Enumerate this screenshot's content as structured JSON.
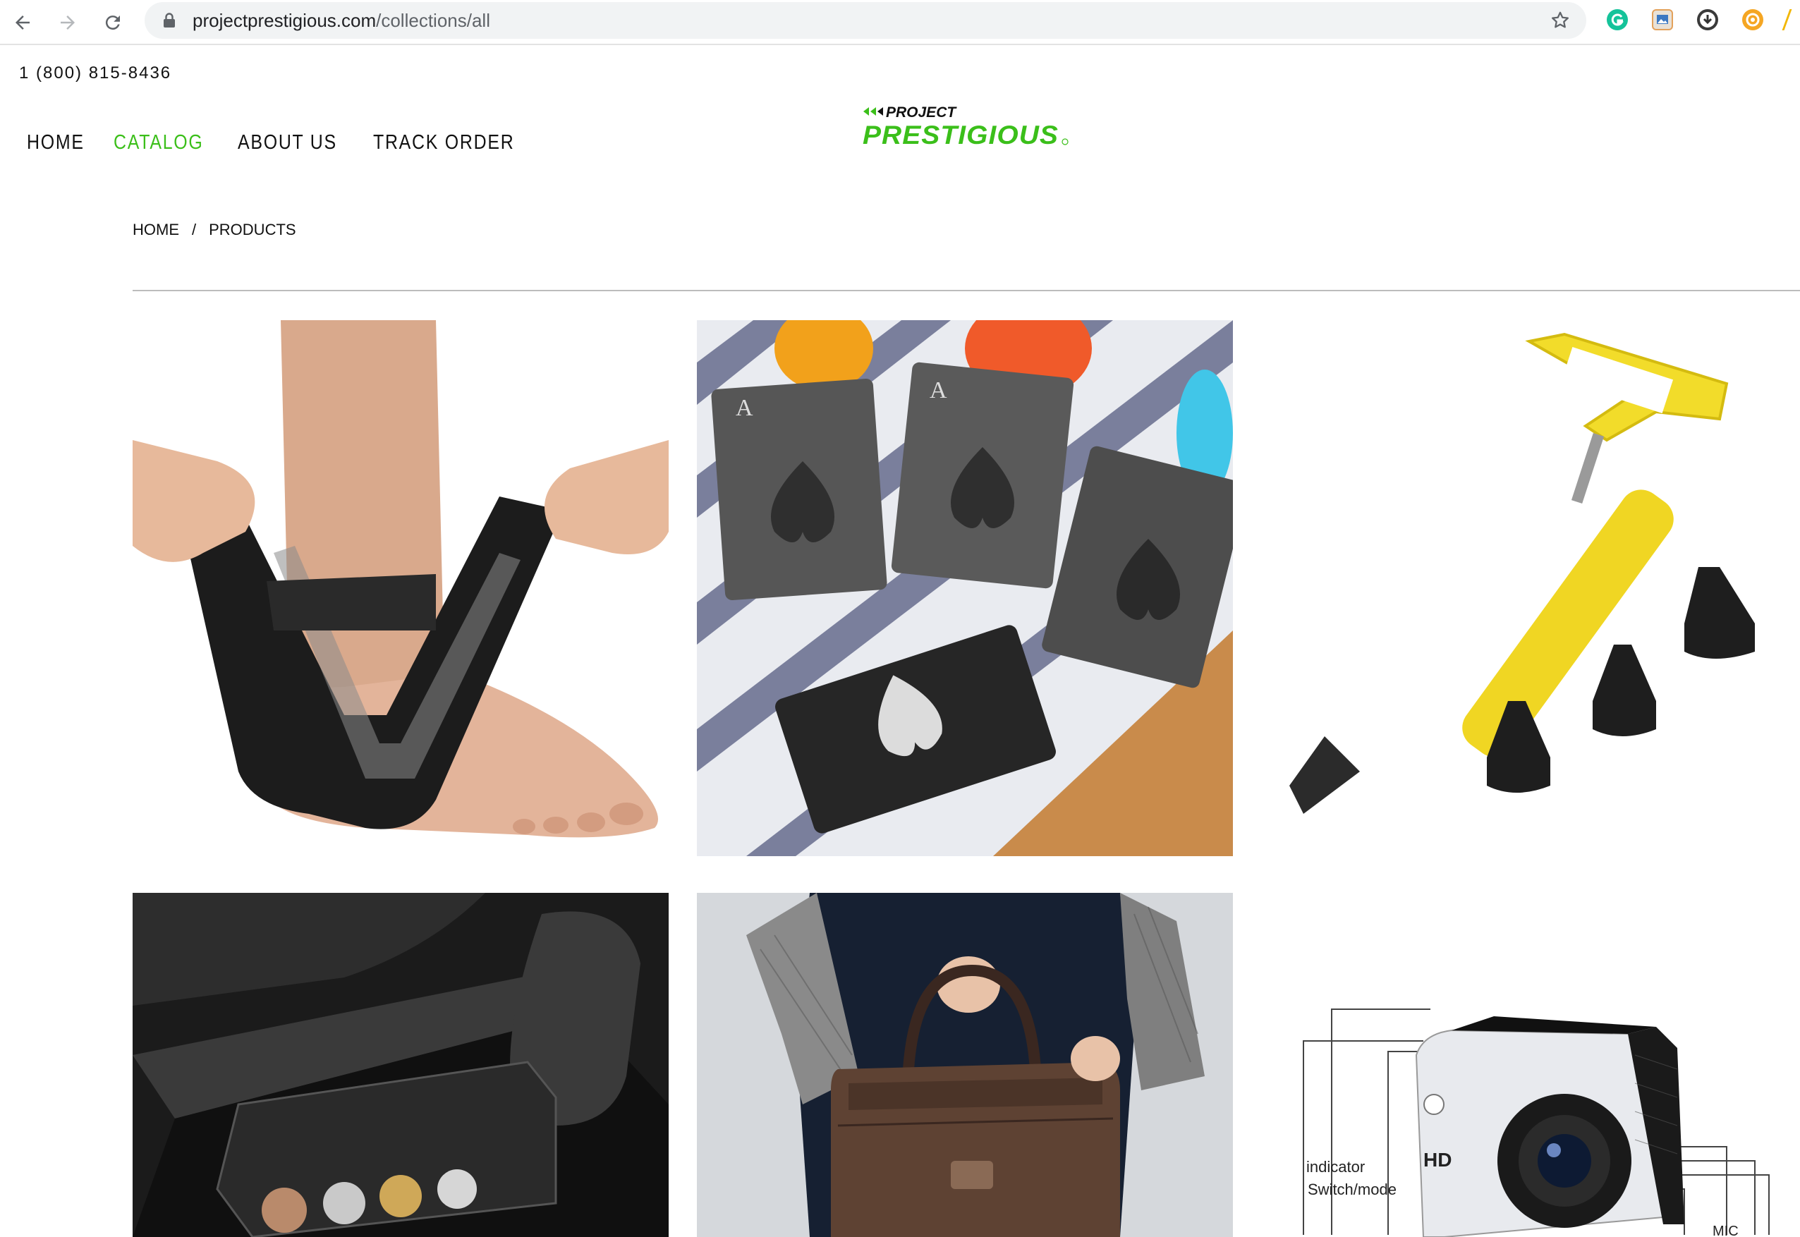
{
  "browser": {
    "url_domain": "projectprestigious.com",
    "url_path": "/collections/all",
    "icons": [
      "back-icon",
      "forward-icon",
      "reload-icon",
      "lock-icon",
      "star-icon",
      "grammarly-icon",
      "image-extension-icon",
      "download-extension-icon",
      "honey-extension-icon"
    ]
  },
  "header": {
    "phone": "1 (800) 815-8436",
    "nav": [
      "HOME",
      "CATALOG",
      "ABOUT US",
      "TRACK ORDER"
    ],
    "active_nav": "CATALOG",
    "logo": {
      "line1": "PROJECT",
      "line2": "PRESTIGIOUS"
    }
  },
  "breadcrumb": {
    "home": "HOME",
    "separator": "/",
    "current": "PRODUCTS"
  },
  "products": [
    {
      "id": "ankle-brace",
      "image": "ankle support brace"
    },
    {
      "id": "card-bottle-opener",
      "image": "ace of spades card bottle openers",
      "card_text": "A"
    },
    {
      "id": "caulking-gun",
      "image": "yellow mortar caulking gun with nozzles"
    },
    {
      "id": "coin-holder",
      "image": "car coin holder"
    },
    {
      "id": "leather-bag",
      "image": "brown leather briefcase"
    },
    {
      "id": "action-camera",
      "image": "HD action camera",
      "labels": [
        "indicator",
        "Switch/mode",
        "HD",
        "MIC"
      ]
    }
  ],
  "colors": {
    "accent_green": "#3bbf1a",
    "text": "#111111"
  }
}
